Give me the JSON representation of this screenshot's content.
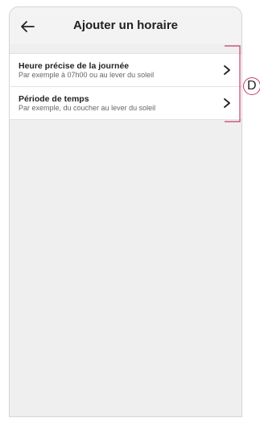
{
  "header": {
    "title": "Ajouter un horaire"
  },
  "options": [
    {
      "title": "Heure précise de la journée",
      "subtitle": "Par exemple à 07h00 ou au lever du soleil"
    },
    {
      "title": "Période de temps",
      "subtitle": "Par exemple, du coucher au lever du soleil"
    }
  ],
  "callout": {
    "label": "D"
  },
  "colors": {
    "callout": "#c63a6b",
    "screen_bg": "#efefef"
  }
}
